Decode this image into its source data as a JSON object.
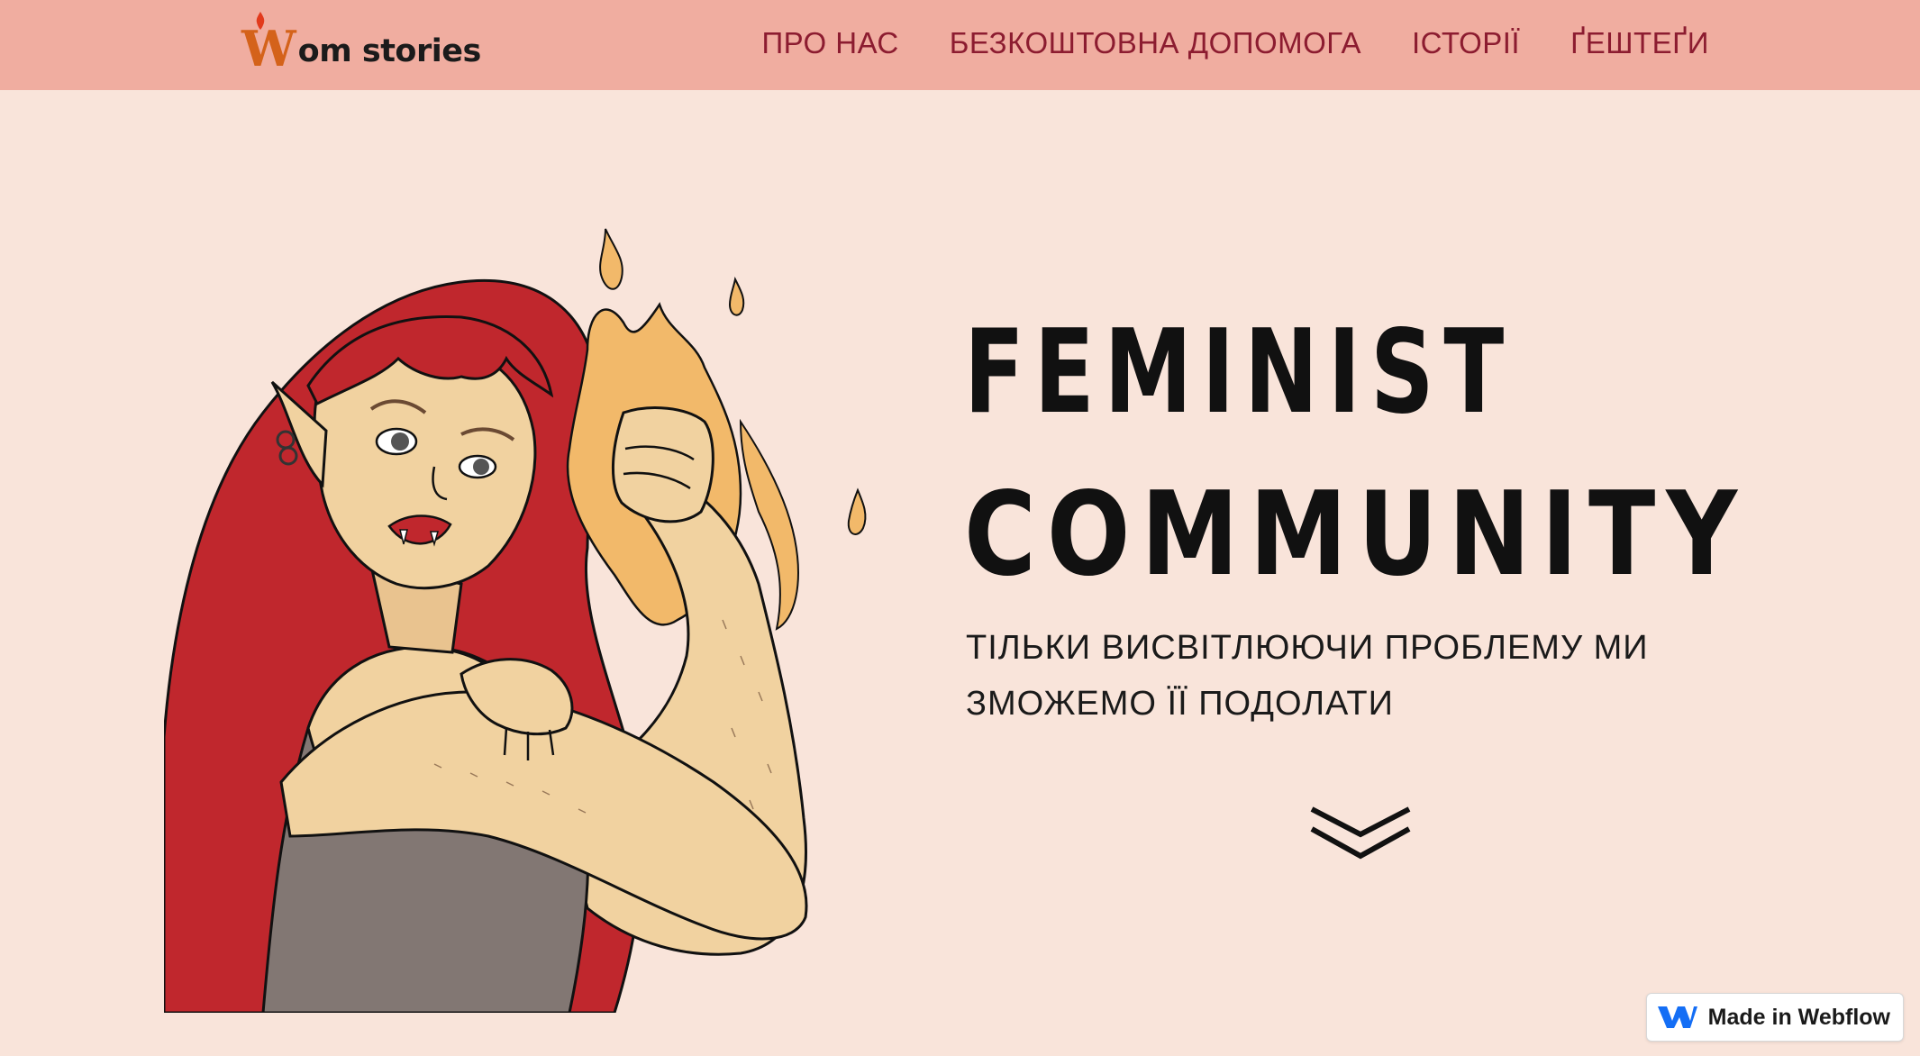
{
  "nav": {
    "logo_letter": "W",
    "logo_text": "om stories",
    "links": [
      {
        "label": "ПРО НАС"
      },
      {
        "label": "БЕЗКОШТОВНА ДОПОМОГА"
      },
      {
        "label": "ІСТОРІЇ"
      },
      {
        "label": "ҐЕШТЕҐИ"
      }
    ]
  },
  "hero": {
    "headline_line1": "FEMINIST",
    "headline_line2": "COMMUNITY",
    "subtitle_line1": "ТІЛЬКИ ВИСВІТЛЮЮЧИ ПРОБЛЕМУ МИ",
    "subtitle_line2": "ЗМОЖЕМО ЇЇ ПОДОЛАТИ",
    "scroll_icon": "chevron-double-down-icon"
  },
  "badge": {
    "label": "Made in Webflow",
    "icon": "webflow-logo-icon"
  },
  "colors": {
    "navbar_bg": "#f0ada0",
    "page_bg": "#f9e4da",
    "nav_text": "#8c1c30",
    "hair": "#c0272d",
    "skin": "#f1d2a0",
    "flame": "#f2b96a",
    "top": "#827773"
  }
}
